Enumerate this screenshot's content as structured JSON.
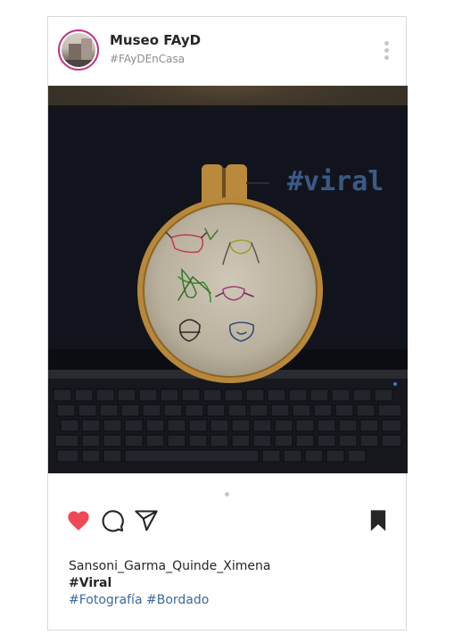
{
  "post": {
    "account_name": "Museo FAyD",
    "account_hashtag": "#FAyDEnCasa",
    "image_text": "#viral",
    "carousel": {
      "count": 1,
      "active": 0
    },
    "liked": true,
    "caption": {
      "author": "Sansoni_Garma_Quinde_Ximena",
      "title": "#Viral",
      "tags": [
        "#Fotografía",
        "#Bordado"
      ]
    }
  },
  "icons": {
    "menu": "more-vertical-icon",
    "like": "heart-icon",
    "comment": "comment-icon",
    "share": "send-icon",
    "save": "bookmark-icon"
  },
  "colors": {
    "heart": "#ed4956",
    "avatar_ring": "#c13584",
    "hashtag_link": "#3b6aa0",
    "image_text": "#3a5a84"
  }
}
